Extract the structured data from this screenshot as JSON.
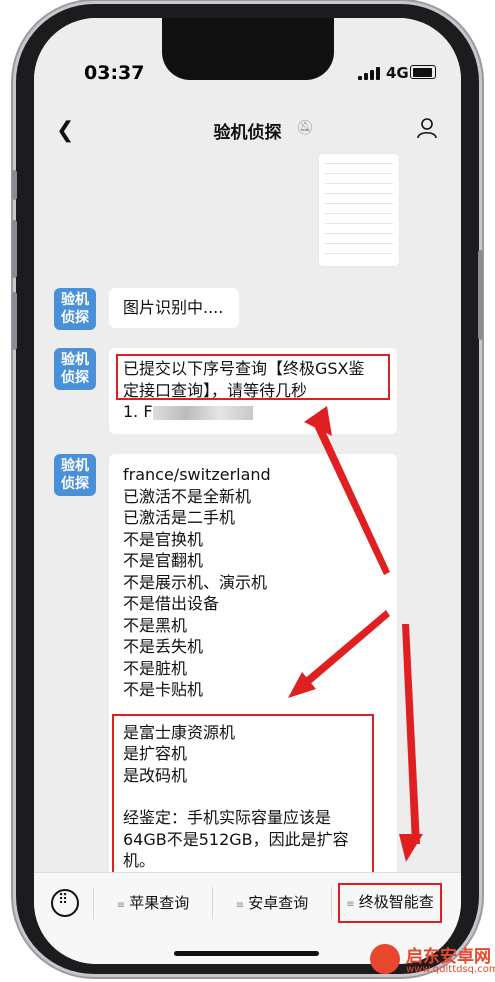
{
  "status": {
    "time": "03:37",
    "network": "4G"
  },
  "nav": {
    "title": "验机侦探"
  },
  "avatar_text": [
    "验机",
    "侦探"
  ],
  "messages": {
    "m1": "图片识别中....",
    "m2": [
      "已提交以下序号查询【终极GSX鉴",
      "定接口查询】，请等待几秒",
      "1. F"
    ],
    "m3": [
      "france/switzerland",
      "已激活不是全新机",
      "已激活是二手机",
      "不是官换机",
      "不是官翻机",
      "不是展示机、演示机",
      "不是借出设备",
      "不是黑机",
      "不是丢失机",
      "不是脏机",
      "不是卡贴机"
    ],
    "m3b": [
      "是富士康资源机",
      "是扩容机",
      "是改码机",
      "",
      "经鉴定：手机实际容量应该是",
      "64GB不是512GB，因此是扩容",
      "机。"
    ]
  },
  "bottom_menu": [
    {
      "label": "苹果查询"
    },
    {
      "label": "安卓查询"
    },
    {
      "label": "终极智能查"
    }
  ],
  "watermark": {
    "name": "启东安卓网",
    "url": "www.qdlttdsq.com"
  },
  "colors": {
    "highlight": "#e02020",
    "avatar": "#4a90d9"
  }
}
